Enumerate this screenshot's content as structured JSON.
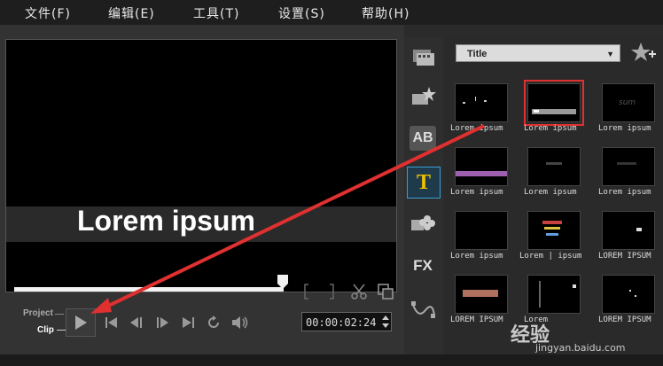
{
  "menu": [
    "文件(F)",
    "编辑(E)",
    "工具(T)",
    "设置(S)",
    "帮助(H)"
  ],
  "preview": {
    "title_text": "Lorem ipsum"
  },
  "player": {
    "mode_project": "Project",
    "mode_clip": "Clip",
    "timecode": "00:00:02:24",
    "scrub_progress": 0.95
  },
  "sidebar": {
    "icons": [
      "media-icon",
      "instant-project-icon",
      "transition-icon",
      "title-icon",
      "graphics-icon",
      "filter-icon",
      "path-icon"
    ],
    "fx_label": "FX",
    "ab_label": "AB"
  },
  "library": {
    "category": "Title",
    "items": [
      {
        "label": "Lorem ipsum"
      },
      {
        "label": "Lorem ipsum"
      },
      {
        "label": "Lorem ipsum"
      },
      {
        "label": "Lorem ipsum"
      },
      {
        "label": "Lorem ipsum"
      },
      {
        "label": "Lorem ipsum"
      },
      {
        "label": "Lorem ipsum"
      },
      {
        "label": "Lorem | ipsum"
      },
      {
        "label": "LOREM IPSUM"
      },
      {
        "label": "LOREM IPSUM"
      },
      {
        "label": "Lorem"
      },
      {
        "label": "LOREM IPSUM"
      }
    ],
    "selected_index": 1
  },
  "watermark": {
    "text": "经验",
    "url": "jingyan.baidu.com"
  },
  "colors": {
    "accent_red": "#e03030"
  }
}
